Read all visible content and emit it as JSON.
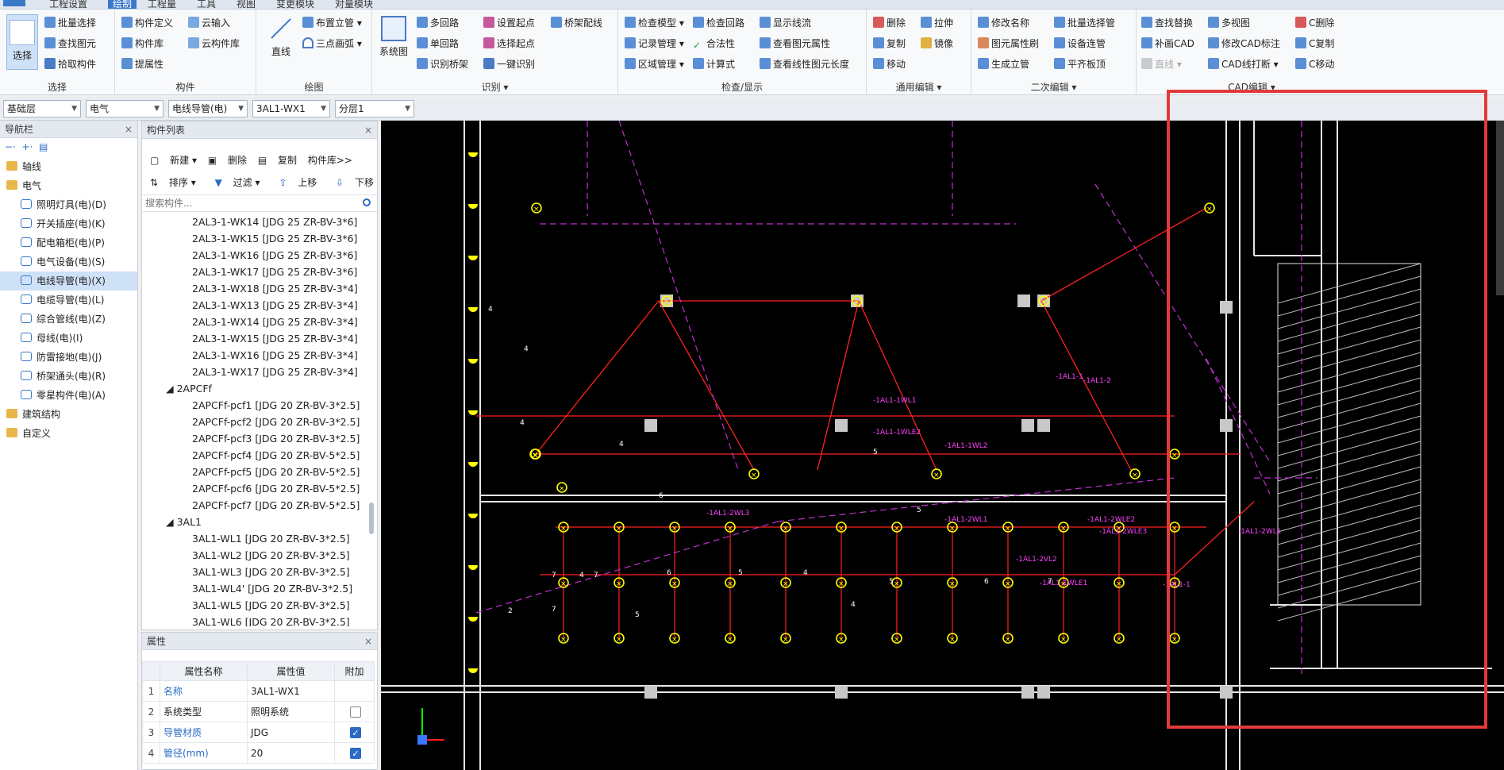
{
  "menu": {
    "tabs": [
      "工程设置",
      "绘制",
      "工程量",
      "工具",
      "视图",
      "变更模块",
      "对量模块"
    ],
    "active_tab": "绘制"
  },
  "ribbon": {
    "select_group": {
      "label": "选择",
      "big_button": "选择",
      "items": [
        "批量选择",
        "查找图元",
        "拾取构件"
      ]
    },
    "component_group": {
      "label": "构件",
      "items": [
        "构件定义",
        "云输入",
        "构件库",
        "云构件库",
        "提属性"
      ]
    },
    "draw_group": {
      "label": "绘图",
      "big_button": "直线",
      "items": [
        "布置立管",
        "三点画弧"
      ]
    },
    "identify_group": {
      "label": "识别",
      "big_button": "系统图",
      "items": [
        "多回路",
        "设置起点",
        "桥架配线",
        "单回路",
        "选择起点",
        "识别桥架",
        "一键识别"
      ]
    },
    "check_group": {
      "label": "检查/显示",
      "items": [
        "检查模型",
        "检查回路",
        "显示线流",
        "记录管理",
        "合法性",
        "查看图元属性",
        "区域管理",
        "计算式",
        "查看线性图元长度"
      ]
    },
    "edit_group": {
      "label": "通用编辑",
      "items": [
        "删除",
        "拉伸",
        "复制",
        "镜像",
        "移动"
      ]
    },
    "secondary_group": {
      "label": "二次编辑",
      "items": [
        "修改名称",
        "批量选择管",
        "图元属性刷",
        "设备连管",
        "生成立管",
        "平齐板顶"
      ]
    },
    "cad_group": {
      "label": "CAD编辑",
      "items": [
        "查找替换",
        "多视图",
        "C删除",
        "补画CAD",
        "修改CAD标注",
        "C复制",
        "直线",
        "CAD线打断",
        "C移动"
      ]
    }
  },
  "layerbar": {
    "floor": "基础层",
    "discipline": "电气",
    "type": "电线导管(电)",
    "component": "3AL1-WX1",
    "sublayer": "分层1"
  },
  "nav": {
    "title": "导航栏",
    "tree": [
      {
        "label": "轴线",
        "level": 0,
        "icon": "folder-icon"
      },
      {
        "label": "电气",
        "level": 0,
        "icon": "folder-icon"
      },
      {
        "label": "照明灯具(电)(D)",
        "level": 1,
        "icon": "bulb-icon"
      },
      {
        "label": "开关插座(电)(K)",
        "level": 1,
        "icon": "switch-icon"
      },
      {
        "label": "配电箱柜(电)(P)",
        "level": 1,
        "icon": "panel-icon"
      },
      {
        "label": "电气设备(电)(S)",
        "level": 1,
        "icon": "plug-icon"
      },
      {
        "label": "电线导管(电)(X)",
        "level": 1,
        "icon": "conduit-icon",
        "selected": true
      },
      {
        "label": "电缆导管(电)(L)",
        "level": 1,
        "icon": "cable-icon"
      },
      {
        "label": "综合管线(电)(Z)",
        "level": 1,
        "icon": "pipeline-icon"
      },
      {
        "label": "母线(电)(I)",
        "level": 1,
        "icon": "busbar-icon"
      },
      {
        "label": "防雷接地(电)(J)",
        "level": 1,
        "icon": "lightning-icon"
      },
      {
        "label": "桥架通头(电)(R)",
        "level": 1,
        "icon": "tray-icon"
      },
      {
        "label": "零星构件(电)(A)",
        "level": 1,
        "icon": "grid-icon"
      },
      {
        "label": "建筑结构",
        "level": 0,
        "icon": "folder-icon"
      },
      {
        "label": "自定义",
        "level": 0,
        "icon": "folder-icon"
      }
    ]
  },
  "complist": {
    "title": "构件列表",
    "toolbar1": [
      "新建",
      "删除",
      "复制",
      "构件库>>"
    ],
    "toolbar2": [
      "排序",
      "过滤",
      "上移",
      "下移"
    ],
    "search_placeholder": "搜索构件...",
    "items": [
      {
        "text": "2AL3-1-WK14 [JDG 25 ZR-BV-3*6]",
        "kind": "child"
      },
      {
        "text": "2AL3-1-WK15 [JDG 25 ZR-BV-3*6]",
        "kind": "child"
      },
      {
        "text": "2AL3-1-WK16 [JDG 25 ZR-BV-3*6]",
        "kind": "child"
      },
      {
        "text": "2AL3-1-WK17 [JDG 25 ZR-BV-3*6]",
        "kind": "child"
      },
      {
        "text": "2AL3-1-WX18 [JDG 25 ZR-BV-3*4]",
        "kind": "child"
      },
      {
        "text": "2AL3-1-WX13 [JDG 25 ZR-BV-3*4]",
        "kind": "child"
      },
      {
        "text": "2AL3-1-WX14 [JDG 25 ZR-BV-3*4]",
        "kind": "child"
      },
      {
        "text": "2AL3-1-WX15 [JDG 25 ZR-BV-3*4]",
        "kind": "child"
      },
      {
        "text": "2AL3-1-WX16 [JDG 25 ZR-BV-3*4]",
        "kind": "child"
      },
      {
        "text": "2AL3-1-WX17 [JDG 25 ZR-BV-3*4]",
        "kind": "child"
      },
      {
        "text": "◢ 2APCFf",
        "kind": "group"
      },
      {
        "text": "2APCFf-pcf1 [JDG 20 ZR-BV-3*2.5]",
        "kind": "child"
      },
      {
        "text": "2APCFf-pcf2 [JDG 20 ZR-BV-3*2.5]",
        "kind": "child"
      },
      {
        "text": "2APCFf-pcf3 [JDG 20 ZR-BV-3*2.5]",
        "kind": "child"
      },
      {
        "text": "2APCFf-pcf4 [JDG 20 ZR-BV-5*2.5]",
        "kind": "child"
      },
      {
        "text": "2APCFf-pcf5 [JDG 20 ZR-BV-5*2.5]",
        "kind": "child"
      },
      {
        "text": "2APCFf-pcf6 [JDG 20 ZR-BV-5*2.5]",
        "kind": "child"
      },
      {
        "text": "2APCFf-pcf7 [JDG 20 ZR-BV-5*2.5]",
        "kind": "child"
      },
      {
        "text": "◢ 3AL1",
        "kind": "group"
      },
      {
        "text": "3AL1-WL1 [JDG 20 ZR-BV-3*2.5]",
        "kind": "child"
      },
      {
        "text": "3AL1-WL2 [JDG 20 ZR-BV-3*2.5]",
        "kind": "child"
      },
      {
        "text": "3AL1-WL3 [JDG 20 ZR-BV-3*2.5]",
        "kind": "child"
      },
      {
        "text": "3AL1-WL4' [JDG 20 ZR-BV-3*2.5]",
        "kind": "child"
      },
      {
        "text": "3AL1-WL5 [JDG 20 ZR-BV-3*2.5]",
        "kind": "child"
      },
      {
        "text": "3AL1-WL6 [JDG 20 ZR-BV-3*2.5]",
        "kind": "child"
      }
    ]
  },
  "props": {
    "title": "属性",
    "headers": [
      "属性名称",
      "属性值",
      "附加"
    ],
    "rows": [
      {
        "n": "1",
        "name": "名称",
        "value": "3AL1-WX1",
        "link": true,
        "check": null
      },
      {
        "n": "2",
        "name": "系统类型",
        "value": "照明系统",
        "link": false,
        "check": false
      },
      {
        "n": "3",
        "name": "导管材质",
        "value": "JDG",
        "link": true,
        "check": true
      },
      {
        "n": "4",
        "name": "管径(mm)",
        "value": "20",
        "link": true,
        "check": true
      }
    ]
  },
  "canvas": {
    "labels": [
      "-1AL1-1WL1",
      "-1AL1-1WLE2",
      "-1AL1-1WL2",
      "-1AL1-2WL3",
      "-1AL1-2WL1",
      "-1AL1-2WLE2",
      "-1AL1-2WLE3",
      "-1AL1-2VL2",
      "-1AL1-1WLE1",
      "-1AL1-1",
      "-1AL1-2WL1",
      "-1AL1-1",
      "-1AL1-2"
    ],
    "numbers": [
      "4",
      "4",
      "4",
      "4",
      "5",
      "5",
      "6",
      "7",
      "7",
      "6",
      "5",
      "4",
      "4",
      "5",
      "6",
      "7",
      "2",
      "7",
      "4",
      "5"
    ],
    "colors": {
      "background": "#000000",
      "wall": "#e6e6e6",
      "conduit": "#ff2020",
      "dashed": "#c030d0",
      "fixture": "#ffff00",
      "highlight": "#e23a3a"
    }
  }
}
